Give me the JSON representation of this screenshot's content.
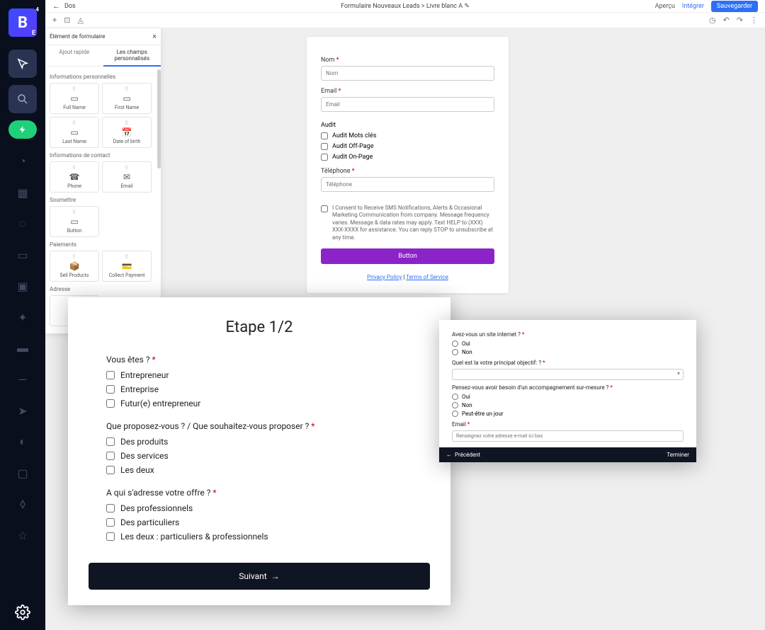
{
  "sidebar": {
    "logo_letter": "B",
    "logo_badge": "4",
    "logo_sub": "E"
  },
  "topbar": {
    "back": "Dos",
    "breadcrumb1": "Formulaire Nouveaux Leads",
    "breadcrumb_sep": " > ",
    "breadcrumb2": "Livre blanc A",
    "preview": "Aperçu",
    "integrate": "Intégrer",
    "save": "Sauvegarder"
  },
  "panel": {
    "title": "Élément de formulaire",
    "tab_quick": "Ajout rapide",
    "tab_custom": "Les champs personnalisés",
    "sections": {
      "personal": "Informations personnelles",
      "contact": "Informations de contact",
      "submit": "Soumettre",
      "payments": "Paiements",
      "address": "Adresse"
    },
    "tiles": {
      "full_name": "Full Name",
      "first_name": "First Name",
      "last_name": "Last Name",
      "dob": "Date of birth",
      "phone": "Phone",
      "email": "Email",
      "button": "Button",
      "sell_products": "Sell Products",
      "collect_payment": "Collect Payment"
    }
  },
  "form": {
    "name_label": "Nom",
    "name_ph": "Nom",
    "email_label": "Email",
    "email_ph": "Email",
    "audit_label": "Audit",
    "audit_keywords": "Audit Mots clés",
    "audit_offpage": "Audit Off-Page",
    "audit_onpage": "Audit On-Page",
    "phone_label": "Téléphone",
    "phone_ph": "Téléphone",
    "consent": "I Consent to Receive SMS Notifications, Alerts & Occasional Marketing Communication from company. Message frequency varies. Message & data rates may apply. Text HELP to (XXX) XXX-XXXX for assistance. You can reply STOP to unsubscribe at any time.",
    "submit": "Button",
    "privacy": "Privacy Policy",
    "sep": " | ",
    "tos": "Terms of Service"
  },
  "step1": {
    "title": "Etape 1/2",
    "q1": "Vous êtes ?",
    "q1_opts": [
      "Entrepreneur",
      "Entreprise",
      "Futur(e) entrepreneur"
    ],
    "q2": "Que proposez-vous ? / Que souhaitez-vous proposer ?",
    "q2_opts": [
      "Des produits",
      "Des services",
      "Les deux"
    ],
    "q3": "A qui s'adresse votre offre ?",
    "q3_opts": [
      "Des professionnels",
      "Des particuliers",
      "Les deux : particuliers & professionnels"
    ],
    "next": "Suivant"
  },
  "step2": {
    "q1": "Avez-vous un site internet ?",
    "q1_opts": [
      "Oui",
      "Non"
    ],
    "q2": "Quel est la votre principal objectif: ?",
    "q3": "Pensez-vous avoir besoin d'un accompagnement sur-mesure ?",
    "q3_opts": [
      "Oui",
      "Non",
      "Peut-être un jour"
    ],
    "email_label": "Email",
    "email_ph": "Renseignez votre adresse e-mail ici bas",
    "prev": "Précédent",
    "finish": "Terminer"
  }
}
